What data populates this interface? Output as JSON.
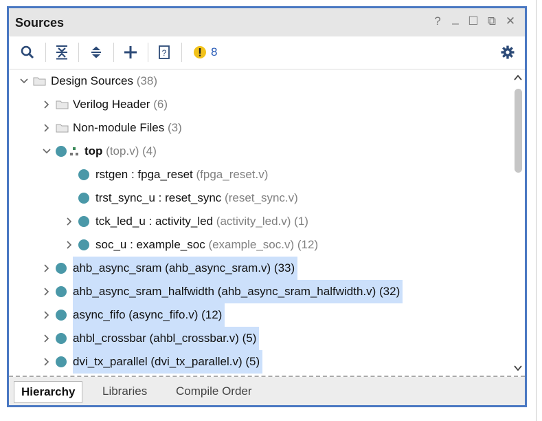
{
  "panel": {
    "title": "Sources",
    "window_controls": [
      "help-icon",
      "minimize-icon",
      "maximize-icon",
      "float-icon",
      "close-icon"
    ],
    "window_control_glyphs": [
      "?",
      "_",
      "☐",
      "⧉",
      "✕"
    ]
  },
  "toolbar": {
    "buttons": [
      "search-icon",
      "collapse-all-icon",
      "expand-all-icon",
      "add-icon",
      "properties-icon"
    ],
    "warning_count": "8",
    "warning_color": "#f2c21a",
    "accent": "#2357b5"
  },
  "tree": {
    "rows": [
      {
        "label": "Design Sources",
        "suffix": "(38)",
        "expander": "expanded"
      },
      {
        "label": "Verilog Header",
        "suffix": "(6)",
        "expander": "collapsed"
      },
      {
        "label": "Non-module Files",
        "suffix": "(3)",
        "expander": "collapsed"
      },
      {
        "label": "top",
        "file": "(top.v)",
        "suffix": "(4)",
        "expander": "expanded"
      },
      {
        "label": "rstgen : fpga_reset",
        "file": "(fpga_reset.v)",
        "expander": "none"
      },
      {
        "label": "trst_sync_u : reset_sync",
        "file": "(reset_sync.v)",
        "expander": "none"
      },
      {
        "label": "tck_led_u : activity_led",
        "file": "(activity_led.v)",
        "suffix": "(1)",
        "expander": "collapsed"
      },
      {
        "label": "soc_u : example_soc",
        "file": "(example_soc.v)",
        "suffix": "(12)",
        "expander": "collapsed"
      },
      {
        "label": "ahb_async_sram (ahb_async_sram.v) (33)",
        "expander": "collapsed",
        "selected": true
      },
      {
        "label": "ahb_async_sram_halfwidth (ahb_async_sram_halfwidth.v) (32)",
        "expander": "collapsed",
        "selected": true
      },
      {
        "label": "async_fifo (async_fifo.v) (12)",
        "expander": "collapsed",
        "selected": true
      },
      {
        "label": "ahbl_crossbar (ahbl_crossbar.v) (5)",
        "expander": "collapsed",
        "selected": true
      },
      {
        "label": "dvi_tx_parallel (dvi_tx_parallel.v) (5)",
        "expander": "collapsed",
        "selected": true
      }
    ],
    "module_dot_color": "#4a98a8",
    "selection_color": "#cce0fb"
  },
  "tabs": {
    "items": [
      "Hierarchy",
      "Libraries",
      "Compile Order"
    ],
    "active": "Hierarchy"
  }
}
